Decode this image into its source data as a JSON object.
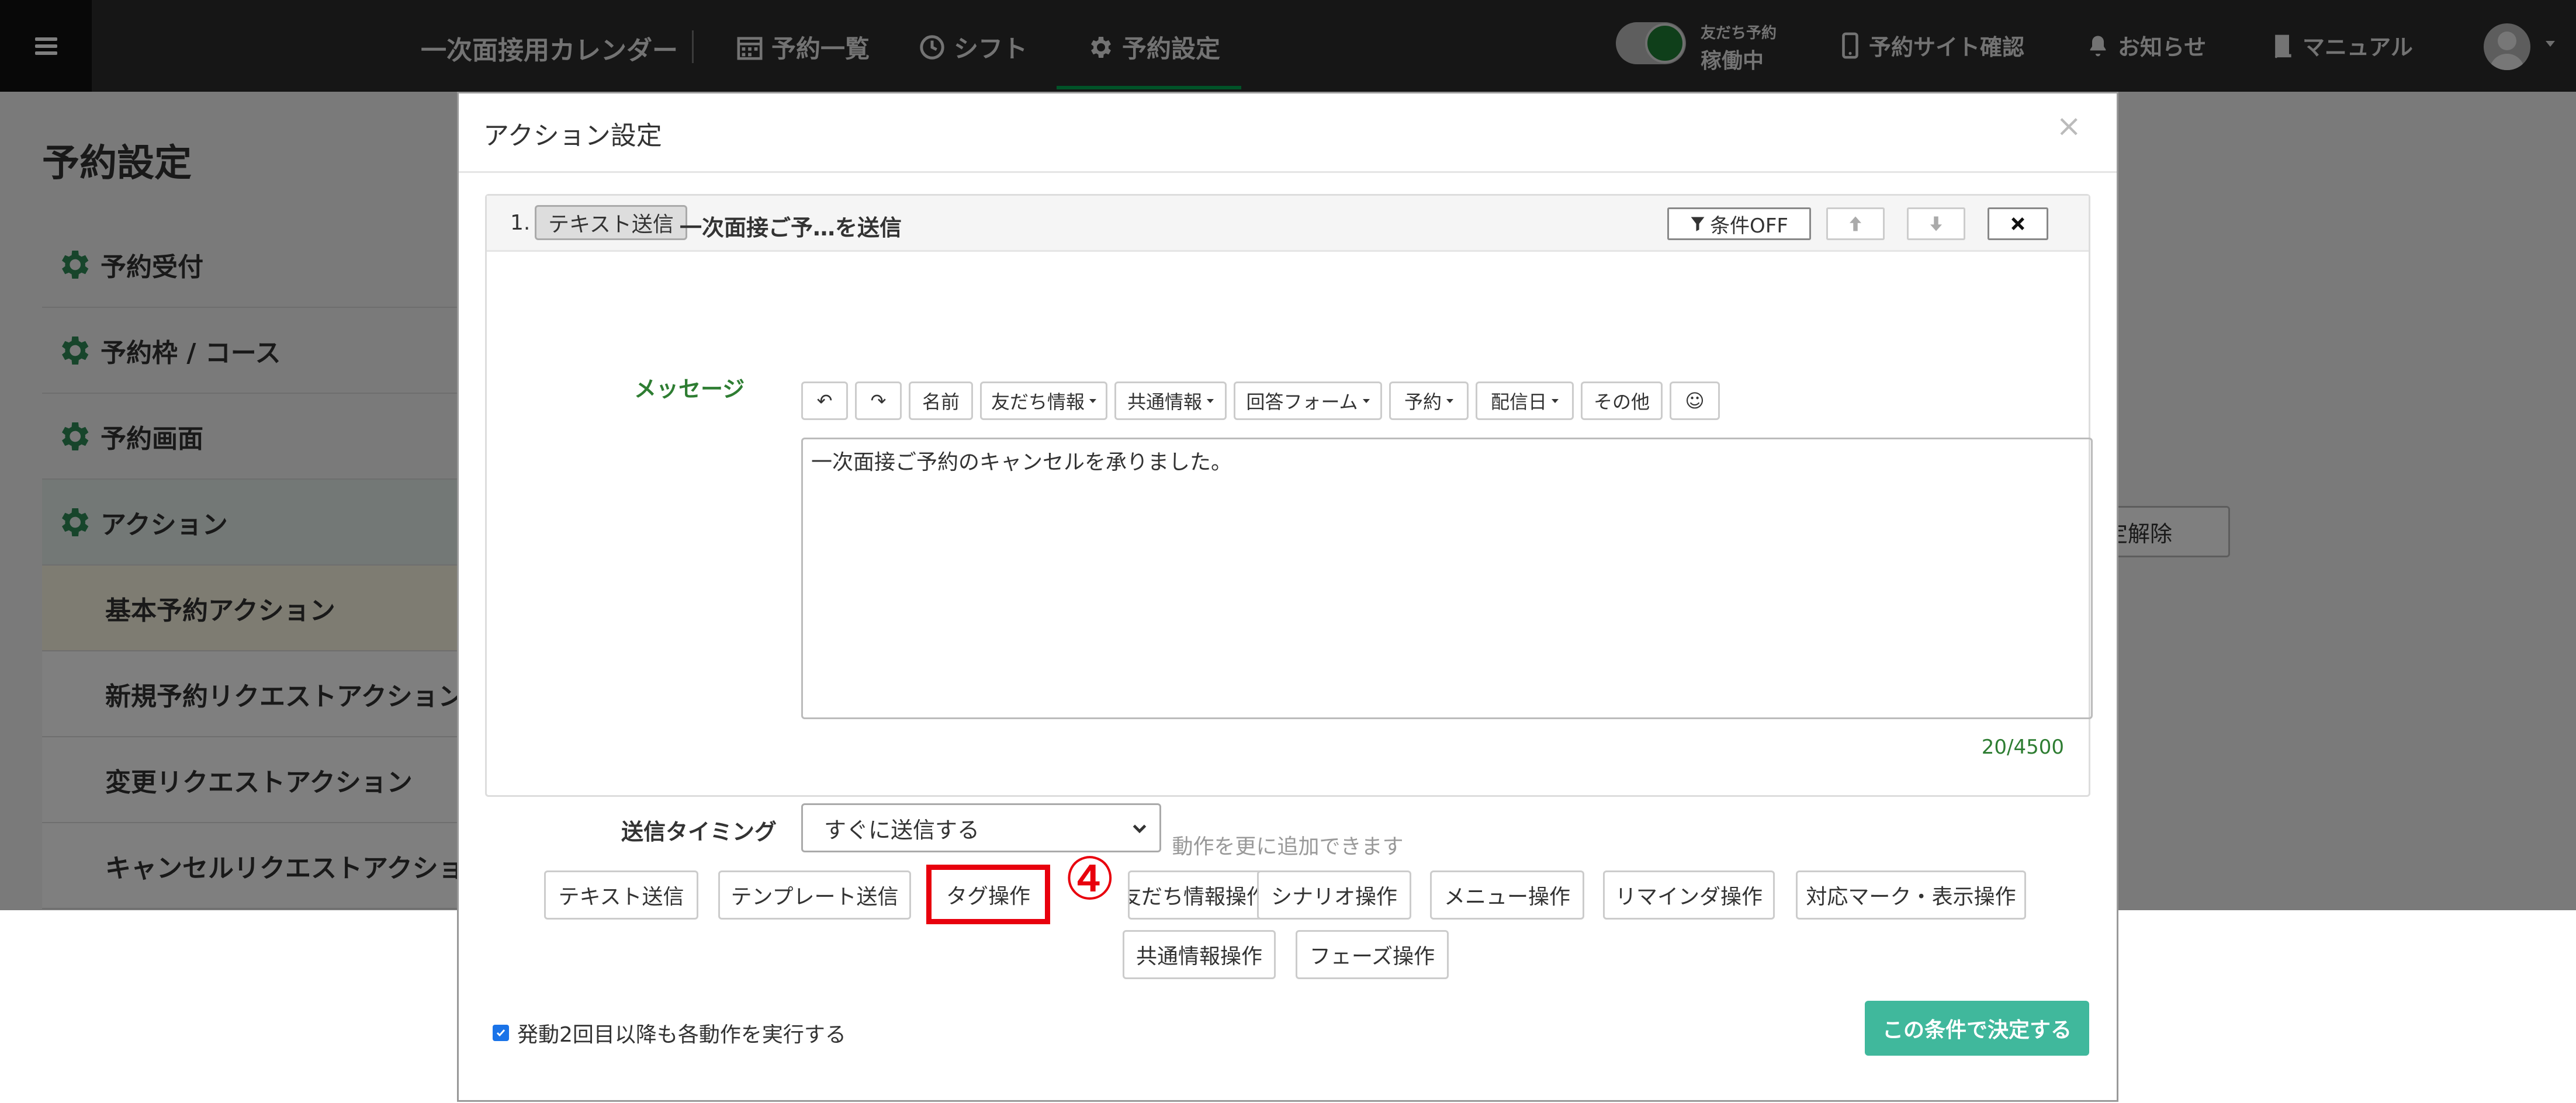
{
  "topbar": {
    "app_title": "一次面接用カレンダー",
    "nav": [
      {
        "label": "予約一覧",
        "icon": "calendar-icon"
      },
      {
        "label": "シフト",
        "icon": "clock-icon"
      },
      {
        "label": "予約設定",
        "icon": "gear-icon",
        "active": true
      }
    ],
    "toggle_label_small": "友だち予約",
    "toggle_label_big": "稼働中",
    "links": [
      {
        "label": "予約サイト確認",
        "icon": "smartphone-icon"
      },
      {
        "label": "お知らせ",
        "icon": "bell-icon"
      },
      {
        "label": "マニュアル",
        "icon": "book-icon"
      }
    ]
  },
  "page": {
    "title": "予約設定",
    "sidebar": [
      {
        "label": "予約受付"
      },
      {
        "label": "予約枠 / コース"
      },
      {
        "label": "予約画面"
      },
      {
        "label": "アクション"
      }
    ],
    "sidebar_sub": [
      {
        "label": "基本予約アクション"
      },
      {
        "label": "新規予約リクエストアクション"
      },
      {
        "label": "変更リクエストアクション"
      },
      {
        "label": "キャンセルリクエストアクション"
      }
    ],
    "background_button": "定解除"
  },
  "modal": {
    "title": "アクション設定",
    "close": "×",
    "action": {
      "number": "1.",
      "type_tag": "テキスト送信",
      "summary": "一次面接ご予…を送信",
      "condition_button": "条件OFF",
      "message_label": "メッセージ",
      "toolbar": [
        {
          "label": "↶",
          "dropdown": false
        },
        {
          "label": "↷",
          "dropdown": false
        },
        {
          "label": "名前",
          "dropdown": false
        },
        {
          "label": "友だち情報",
          "dropdown": true
        },
        {
          "label": "共通情報",
          "dropdown": true
        },
        {
          "label": "回答フォーム",
          "dropdown": true
        },
        {
          "label": "予約",
          "dropdown": true
        },
        {
          "label": "配信日",
          "dropdown": true
        },
        {
          "label": "その他",
          "dropdown": false
        },
        {
          "label": "☺",
          "dropdown": false
        }
      ],
      "message_text": "一次面接ご予約のキャンセルを承りました。",
      "counter": "20/4500",
      "timing_label": "送信タイミング",
      "timing_value": "すぐに送信する"
    },
    "add_hint": "動作を更に追加できます",
    "add_buttons_row1": [
      "テキスト送信",
      "テンプレート送信",
      "タグ操作",
      "友だち情報操作",
      "シナリオ操作",
      "メニュー操作",
      "リマインダ操作",
      "対応マーク・表示操作"
    ],
    "add_buttons_row2": [
      "共通情報操作",
      "フェーズ操作"
    ],
    "step_marker": "④",
    "repeat_checkbox_label": "発動2回目以降も各動作を実行する",
    "submit_label": "この条件で決定する"
  },
  "colors": {
    "topbar_bg": "#2c2c2c",
    "accent_green": "#00a651",
    "submit_bg": "#40b89c",
    "highlight_red": "#e8000d"
  }
}
